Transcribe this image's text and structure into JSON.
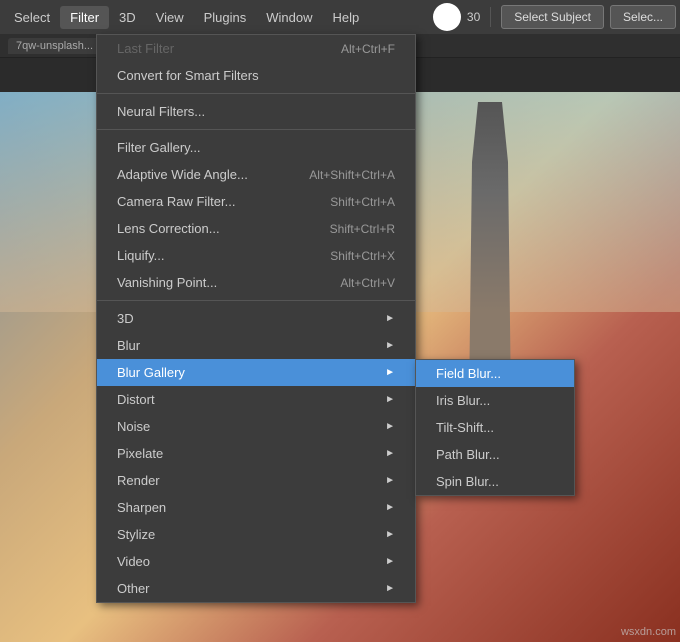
{
  "menuBar": {
    "items": [
      {
        "label": "Select",
        "id": "select"
      },
      {
        "label": "Filter",
        "id": "filter",
        "active": true
      },
      {
        "label": "3D",
        "id": "3d"
      },
      {
        "label": "View",
        "id": "view"
      },
      {
        "label": "Plugins",
        "id": "plugins"
      },
      {
        "label": "Window",
        "id": "window"
      },
      {
        "label": "Help",
        "id": "help"
      }
    ]
  },
  "toolbar": {
    "brushSize": "30",
    "selectSubjectLabel": "Select Subject",
    "selectLabel": "Selec..."
  },
  "tab": {
    "label": "7qw-unsplash..."
  },
  "filterMenu": {
    "items": [
      {
        "label": "Last Filter",
        "shortcut": "Alt+Ctrl+F",
        "disabled": true,
        "id": "last-filter"
      },
      {
        "label": "Convert for Smart Filters",
        "shortcut": "",
        "id": "convert-smart"
      },
      {
        "label": "Neural Filters...",
        "shortcut": "",
        "id": "neural-filters"
      },
      {
        "label": "Filter Gallery...",
        "shortcut": "",
        "id": "filter-gallery"
      },
      {
        "label": "Adaptive Wide Angle...",
        "shortcut": "Alt+Shift+Ctrl+A",
        "id": "adaptive-wide"
      },
      {
        "label": "Camera Raw Filter...",
        "shortcut": "Shift+Ctrl+A",
        "id": "camera-raw"
      },
      {
        "label": "Lens Correction...",
        "shortcut": "Shift+Ctrl+R",
        "id": "lens-correction"
      },
      {
        "label": "Liquify...",
        "shortcut": "Shift+Ctrl+X",
        "id": "liquify"
      },
      {
        "label": "Vanishing Point...",
        "shortcut": "Alt+Ctrl+V",
        "id": "vanishing-point"
      },
      {
        "label": "3D",
        "submenu": true,
        "id": "3d-filter"
      },
      {
        "label": "Blur",
        "submenu": true,
        "id": "blur"
      },
      {
        "label": "Blur Gallery",
        "submenu": true,
        "active": true,
        "id": "blur-gallery"
      },
      {
        "label": "Distort",
        "submenu": true,
        "id": "distort"
      },
      {
        "label": "Noise",
        "submenu": true,
        "id": "noise"
      },
      {
        "label": "Pixelate",
        "submenu": true,
        "id": "pixelate"
      },
      {
        "label": "Render",
        "submenu": true,
        "id": "render"
      },
      {
        "label": "Sharpen",
        "submenu": true,
        "id": "sharpen"
      },
      {
        "label": "Stylize",
        "submenu": true,
        "id": "stylize"
      },
      {
        "label": "Video",
        "submenu": true,
        "id": "video"
      },
      {
        "label": "Other",
        "submenu": true,
        "id": "other"
      }
    ],
    "separators": [
      1,
      2,
      8,
      9
    ]
  },
  "blurGallerySubmenu": {
    "items": [
      {
        "label": "Field Blur...",
        "active": true,
        "id": "field-blur"
      },
      {
        "label": "Iris Blur...",
        "id": "iris-blur"
      },
      {
        "label": "Tilt-Shift...",
        "id": "tilt-shift"
      },
      {
        "label": "Path Blur...",
        "id": "path-blur"
      },
      {
        "label": "Spin Blur...",
        "id": "spin-blur"
      }
    ]
  },
  "watermark": "wsxdn.com"
}
